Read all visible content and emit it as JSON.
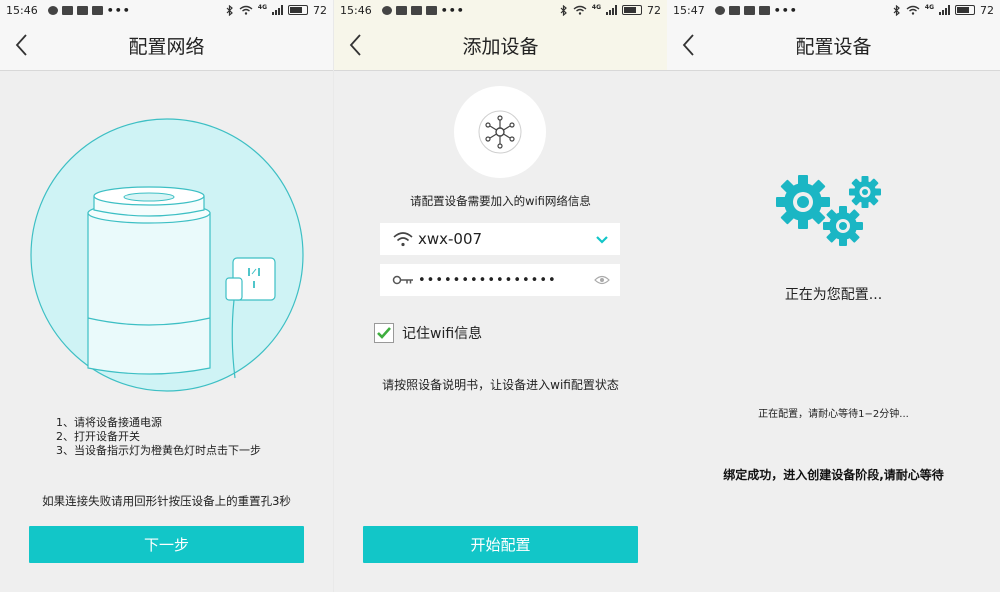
{
  "screens": [
    {
      "status": {
        "time": "15:46",
        "battery": "72",
        "battery_level": 0.72,
        "network": "4G"
      },
      "title": "配置网络",
      "steps": [
        "1、请将设备接通电源",
        "2、打开设备开关",
        "3、当设备指示灯为橙黄色灯时点击下一步"
      ],
      "note": "如果连接失败请用回形针按压设备上的重置孔3秒",
      "button": "下一步",
      "icons": [
        "back-arrow-icon",
        "device-plug-illustration"
      ]
    },
    {
      "status": {
        "time": "15:46",
        "battery": "72",
        "battery_level": 0.72,
        "network": "4G"
      },
      "title": "添加设备",
      "info_label": "请配置设备需要加入的wifi网络信息",
      "ssid": "xwx-007",
      "password_masked": "••••••••••••••••",
      "remember_label": "记住wifi信息",
      "remember_checked": true,
      "hint": "请按照设备说明书，让设备进入wifi配置状态",
      "button": "开始配置",
      "icons": [
        "back-arrow-icon",
        "network-hub-icon",
        "wifi-icon",
        "chevron-down-icon",
        "key-icon",
        "eye-icon",
        "checkmark-icon"
      ]
    },
    {
      "status": {
        "time": "15:47",
        "battery": "72",
        "battery_level": 0.72,
        "network": "4G"
      },
      "title": "配置设备",
      "configuring": "正在为您配置...",
      "wait": "正在配置，请耐心等待1−2分钟...",
      "bind": "绑定成功，进入创建设备阶段,请耐心等待",
      "icons": [
        "back-arrow-icon",
        "gears-icon"
      ]
    }
  ],
  "colors": {
    "accent": "#12c6c8",
    "illustration": "#cff3f5",
    "stroke": "#3dbfc4",
    "text": "#222222"
  }
}
